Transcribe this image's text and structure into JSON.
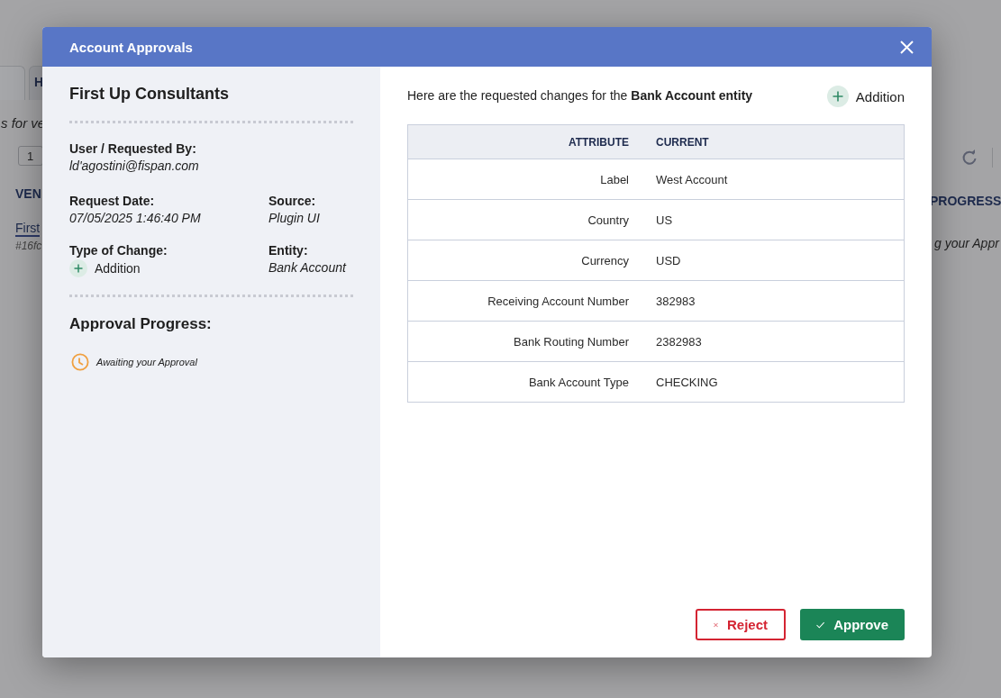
{
  "background": {
    "tabs": [
      {
        "selected": true
      },
      {
        "label": "H",
        "selected": false
      }
    ],
    "subtitle": "s for ve",
    "page_field": "1",
    "column_1": "VEN",
    "row_link": "First",
    "row_id": "#16fc",
    "column_progress": "PROGRESS",
    "row_progress": "g your Appr"
  },
  "dialog": {
    "title": "Account Approvals",
    "summary": {
      "company": "First Up Consultants",
      "requested_by": {
        "label": "User / Requested By:",
        "value": "ld'agostini@fispan.com"
      },
      "request_date": {
        "label": "Request Date:",
        "value": "07/05/2025 1:46:40 PM"
      },
      "source": {
        "label": "Source:",
        "value": "Plugin UI"
      },
      "type_of_change": {
        "label": "Type of Change:",
        "value": "Addition"
      },
      "entity": {
        "label": "Entity:",
        "value": "Bank Account"
      },
      "progress_title": "Approval Progress:",
      "progress_status": "Awaiting your Approval"
    },
    "intro": "Here are the requested changes for the **Bank Account entity**",
    "change_type": "Addition",
    "table": {
      "columns": [
        "ATTRIBUTE",
        "CURRENT"
      ],
      "rows": [
        [
          "Label",
          "West Account"
        ],
        [
          "Country",
          "US"
        ],
        [
          "Currency",
          "USD"
        ],
        [
          "Receiving Account Number",
          "382983"
        ],
        [
          "Bank Routing Number",
          "2382983"
        ],
        [
          "Bank Account Type",
          "CHECKING"
        ]
      ]
    },
    "buttons": [
      {
        "kind": "reject",
        "label": "Reject"
      },
      {
        "kind": "approve",
        "label": "Approve"
      }
    ]
  }
}
